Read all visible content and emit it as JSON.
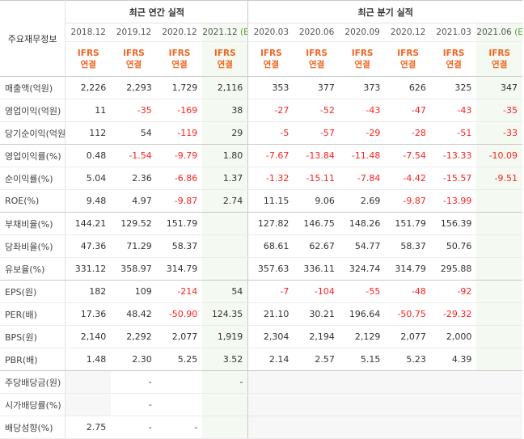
{
  "header": {
    "label_title": "주요재무정보",
    "annual_title": "최근 연간 실적",
    "quarter_title": "최근 분기 실적",
    "annual_periods": [
      "2018.12",
      "2019.12",
      "2020.12",
      "2021.12"
    ],
    "annual_est_suffix": "(E)",
    "quarter_periods": [
      "2020.03",
      "2020.06",
      "2020.09",
      "2020.12",
      "2021.03",
      "2021.06"
    ],
    "quarter_est_suffix": "(E)",
    "ifrs_top": "IFRS",
    "ifrs_bottom": "연결"
  },
  "colors": {
    "negative": "#ff1f1f",
    "ifrs": "#f26522",
    "estimate": "#5a9d3a",
    "estimate_bg": "#f4f9f1"
  },
  "rows": [
    {
      "label": "매출액(억원)",
      "values": [
        "2,226",
        "2,293",
        "1,729",
        "2,116",
        "353",
        "377",
        "373",
        "626",
        "325",
        "347"
      ]
    },
    {
      "label": "영업이익(억원)",
      "values": [
        "11",
        "-35",
        "-169",
        "38",
        "-27",
        "-52",
        "-43",
        "-47",
        "-43",
        "-35"
      ]
    },
    {
      "label": "당기순이익(억원)",
      "values": [
        "112",
        "54",
        "-119",
        "29",
        "-5",
        "-57",
        "-29",
        "-28",
        "-51",
        "-33"
      ]
    },
    {
      "label": "영업이익률(%)",
      "values": [
        "0.48",
        "-1.54",
        "-9.79",
        "1.80",
        "-7.67",
        "-13.84",
        "-11.48",
        "-7.54",
        "-13.33",
        "-10.09"
      ]
    },
    {
      "label": "순이익률(%)",
      "values": [
        "5.04",
        "2.36",
        "-6.86",
        "1.37",
        "-1.32",
        "-15.11",
        "-7.84",
        "-4.42",
        "-15.57",
        "-9.51"
      ]
    },
    {
      "label": "ROE(%)",
      "values": [
        "9.48",
        "4.97",
        "-9.87",
        "2.74",
        "11.15",
        "9.06",
        "2.69",
        "-9.87",
        "-13.99",
        ""
      ]
    },
    {
      "label": "부채비율(%)",
      "values": [
        "144.21",
        "129.52",
        "151.79",
        "",
        "127.82",
        "146.75",
        "148.26",
        "151.79",
        "156.39",
        ""
      ]
    },
    {
      "label": "당좌비율(%)",
      "values": [
        "47.36",
        "71.29",
        "58.37",
        "",
        "68.61",
        "62.67",
        "54.77",
        "58.37",
        "50.76",
        ""
      ]
    },
    {
      "label": "유보율(%)",
      "values": [
        "331.12",
        "358.97",
        "314.79",
        "",
        "357.63",
        "336.11",
        "324.74",
        "314.79",
        "295.88",
        ""
      ]
    },
    {
      "label": "EPS(원)",
      "values": [
        "182",
        "109",
        "-214",
        "54",
        "-7",
        "-104",
        "-55",
        "-48",
        "-92",
        ""
      ]
    },
    {
      "label": "PER(배)",
      "values": [
        "17.36",
        "48.42",
        "-50.90",
        "124.35",
        "21.10",
        "30.21",
        "196.64",
        "-50.75",
        "-29.32",
        ""
      ]
    },
    {
      "label": "BPS(원)",
      "values": [
        "2,140",
        "2,292",
        "2,077",
        "1,919",
        "2,304",
        "2,194",
        "2,129",
        "2,077",
        "2,000",
        ""
      ]
    },
    {
      "label": "PBR(배)",
      "values": [
        "1.48",
        "2.30",
        "5.25",
        "3.52",
        "2.14",
        "2.57",
        "5.15",
        "5.23",
        "4.39",
        ""
      ]
    },
    {
      "label": "주당배당금(원)",
      "values": [
        "",
        "-",
        "",
        "-",
        "",
        "",
        "",
        "",
        "",
        ""
      ],
      "empty_cols": [
        0,
        4,
        5,
        6,
        7,
        8,
        9
      ]
    },
    {
      "label": "시가배당률(%)",
      "values": [
        "",
        "-",
        "",
        "",
        "",
        "",
        "",
        "",
        "",
        ""
      ],
      "empty_cols": [
        0,
        4,
        5,
        6,
        7,
        8,
        9
      ]
    },
    {
      "label": "배당성향(%)",
      "values": [
        "2.75",
        "-",
        "-",
        "",
        "",
        "",
        "",
        "",
        "",
        ""
      ],
      "empty_cols": [
        4,
        5,
        6,
        7,
        8,
        9
      ]
    }
  ],
  "group_end_rows": [
    2,
    5,
    8,
    12
  ]
}
